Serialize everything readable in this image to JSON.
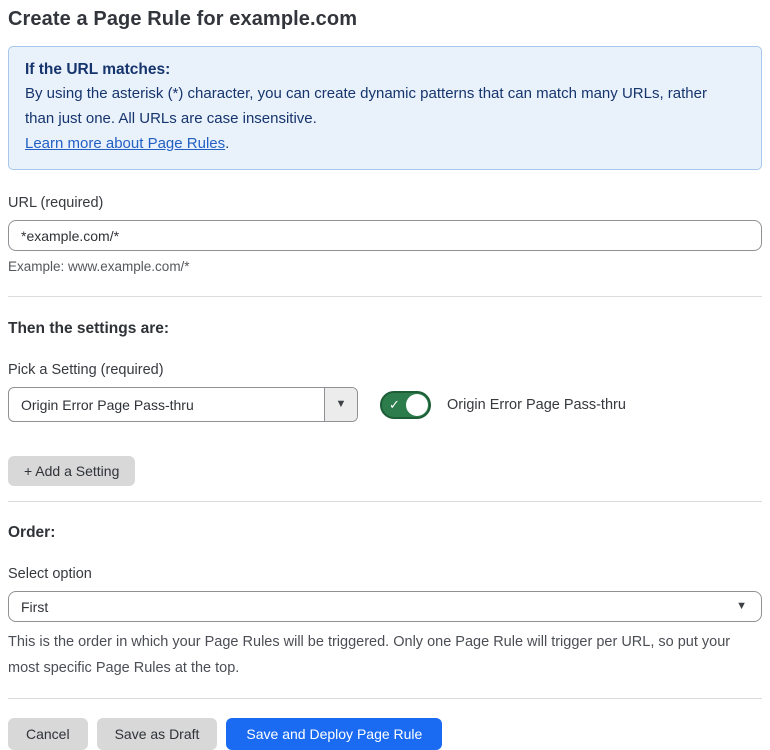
{
  "page": {
    "title": "Create a Page Rule for example.com"
  },
  "info_box": {
    "heading": "If the URL matches:",
    "body": "By using the asterisk (*) character, you can create dynamic patterns that can match many URLs, rather than just one. All URLs are case insensitive.",
    "link_label": "Learn more about Page Rules",
    "link_suffix": "."
  },
  "url_field": {
    "label": "URL (required)",
    "value": "*example.com/*",
    "hint": "Example: www.example.com/*"
  },
  "settings_section": {
    "heading": "Then the settings are:",
    "picker_label": "Pick a Setting (required)",
    "picker_value": "Origin Error Page Pass-thru",
    "toggle_state": "on",
    "toggle_check_glyph": "✓",
    "toggle_label": "Origin Error Page Pass-thru",
    "add_setting_label": "+ Add a Setting"
  },
  "order_section": {
    "heading": "Order:",
    "select_label": "Select option",
    "select_value": "First",
    "help_text": "This is the order in which your Page Rules will be triggered. Only one Page Rule will trigger per URL, so put your most specific Page Rules at the top."
  },
  "actions": {
    "cancel_label": "Cancel",
    "save_draft_label": "Save as Draft",
    "save_deploy_label": "Save and Deploy Page Rule"
  },
  "icons": {
    "dropdown_arrow": "▼",
    "select_arrow": "▼"
  },
  "colors": {
    "info_bg": "#e9f1fb",
    "info_border": "#a8c7ec",
    "info_text": "#16356d",
    "link": "#2260c4",
    "toggle_green": "#2d7c4c",
    "toggle_green_border": "#1d5e37",
    "primary_button": "#1a6bf2",
    "gray_button": "#d8d8d8"
  }
}
